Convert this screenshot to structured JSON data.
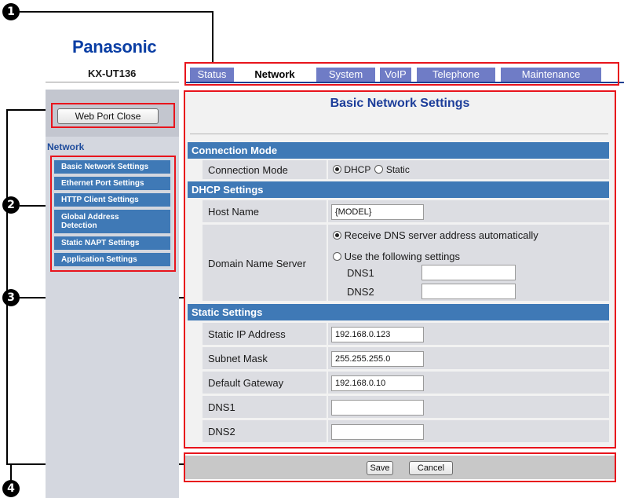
{
  "callouts": [
    "1",
    "2",
    "3",
    "4"
  ],
  "header": {
    "logo": "Panasonic",
    "model": "KX-UT136"
  },
  "tabs": [
    {
      "label": "Status",
      "active": false
    },
    {
      "label": "Network",
      "active": true
    },
    {
      "label": "System",
      "active": false
    },
    {
      "label": "VoIP",
      "active": false
    },
    {
      "label": "Telephone",
      "active": false
    },
    {
      "label": "Maintenance",
      "active": false
    }
  ],
  "sidebar": {
    "web_port_button": "Web Port Close",
    "heading": "Network",
    "items": [
      {
        "label": "Basic Network Settings"
      },
      {
        "label": "Ethernet Port Settings"
      },
      {
        "label": "HTTP Client Settings"
      },
      {
        "label": "Global Address Detection"
      },
      {
        "label": "Static NAPT Settings"
      },
      {
        "label": "Application Settings"
      }
    ]
  },
  "main": {
    "title": "Basic Network Settings",
    "connection_section": "Connection Mode",
    "connection_label": "Connection Mode",
    "connection_options": [
      "DHCP",
      "Static"
    ],
    "connection_selected": "DHCP",
    "dhcp_section": "DHCP Settings",
    "host_name_label": "Host Name",
    "host_name_value": "{MODEL}",
    "dns_label": "Domain Name Server",
    "dns_auto_option": "Receive DNS server address automatically",
    "dns_manual_option": "Use the following settings",
    "dns_selected": "auto",
    "dns1_label": "DNS1",
    "dns1_value": "",
    "dns2_label": "DNS2",
    "dns2_value": "",
    "static_section": "Static Settings",
    "static_ip_label": "Static IP Address",
    "static_ip_value": "192.168.0.123",
    "subnet_label": "Subnet Mask",
    "subnet_value": "255.255.255.0",
    "gateway_label": "Default Gateway",
    "gateway_value": "192.168.0.10",
    "static_dns1_label": "DNS1",
    "static_dns1_value": "",
    "static_dns2_label": "DNS2",
    "static_dns2_value": ""
  },
  "footer": {
    "save_label": "Save",
    "cancel_label": "Cancel"
  },
  "colors": {
    "accent_blue": "#3f79b6",
    "tab_blue": "#6f7cc6",
    "title_blue": "#1d3e9a",
    "callout_red": "#e8141c"
  }
}
